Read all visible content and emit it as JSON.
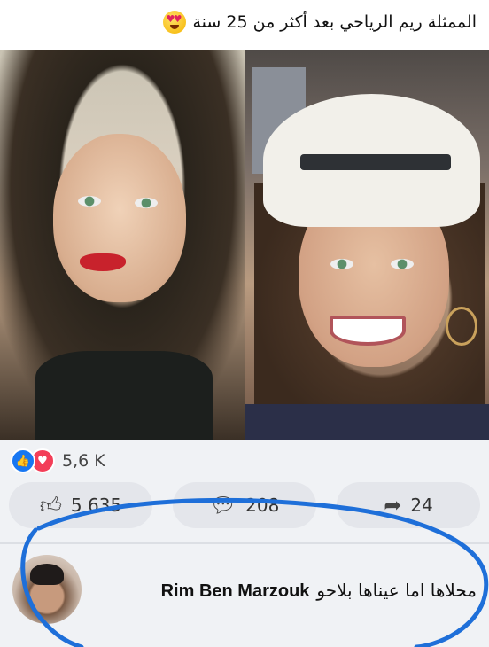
{
  "post": {
    "caption": "الممثلة ريم الرياحي بعد أكثر من 25 سنة",
    "caption_emoji": "smiling-face-with-heart-eyes"
  },
  "reactions": {
    "count": "5,6 K",
    "like_count": "5 635",
    "comment_count": "208",
    "share_count": "24",
    "icons": [
      "like-icon",
      "love-icon"
    ]
  },
  "comment": {
    "author": "Rim Ben Marzouk",
    "text": "محلاها اما عيناها بلاحو"
  },
  "colors": {
    "like_blue": "#1877f2",
    "love_red": "#f33e58",
    "annotation_blue": "#1e6fd9",
    "background_grey": "#f0f2f5"
  }
}
